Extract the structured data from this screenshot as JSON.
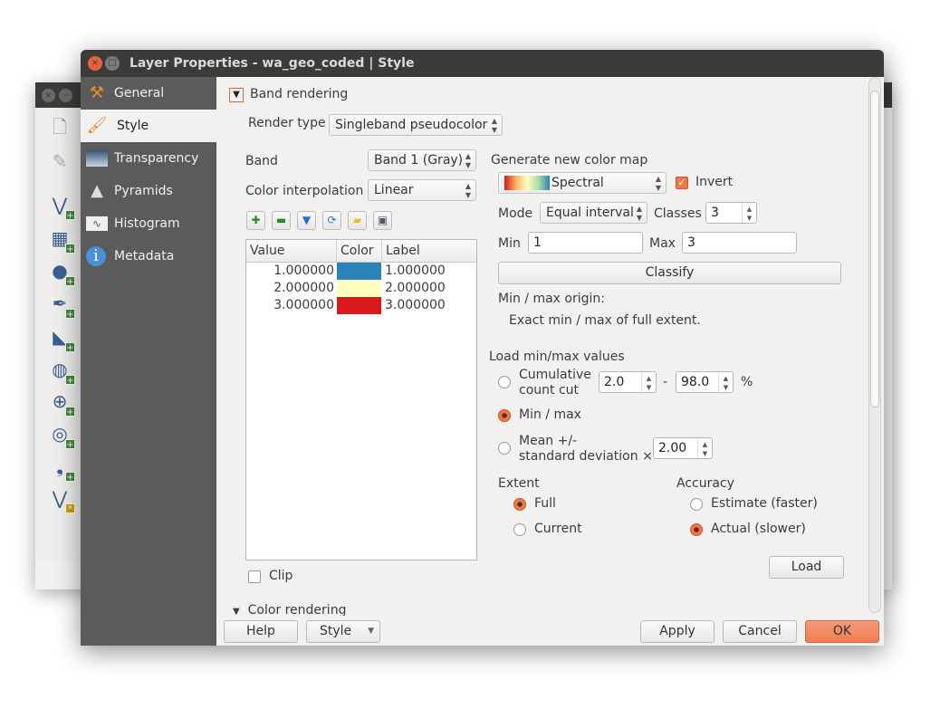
{
  "background_window": {
    "toolbar_icons": [
      "new-project-icon",
      "edit-pencil-icon",
      "add-vector-layer-icon",
      "add-raster-layer-icon",
      "add-postgis-layer-icon",
      "add-spatialite-layer-icon",
      "add-mssql-layer-icon",
      "add-wms-layer-icon",
      "add-wcs-layer-icon",
      "add-wfs-layer-icon",
      "add-delimited-text-layer-icon",
      "new-shapefile-layer-icon"
    ]
  },
  "dialog": {
    "title": "Layer Properties - wa_geo_coded | Style"
  },
  "sidebar": {
    "items": [
      {
        "label": "General",
        "icon": "tools-icon"
      },
      {
        "label": "Style",
        "icon": "paintbrush-icon",
        "selected": true
      },
      {
        "label": "Transparency",
        "icon": "transparency-icon"
      },
      {
        "label": "Pyramids",
        "icon": "pyramids-icon"
      },
      {
        "label": "Histogram",
        "icon": "histogram-icon"
      },
      {
        "label": "Metadata",
        "icon": "info-icon"
      }
    ]
  },
  "band_rendering": {
    "section_label": "Band rendering",
    "render_type_label": "Render type",
    "render_type": "Singleband pseudocolor",
    "band_label": "Band",
    "band": "Band 1 (Gray)",
    "interp_label": "Color interpolation",
    "interp": "Linear",
    "table": {
      "headers": [
        "Value",
        "Color",
        "Label"
      ],
      "rows": [
        {
          "value": "1.000000",
          "color": "#2b83ba",
          "label": "1.000000"
        },
        {
          "value": "2.000000",
          "color": "#ffffbf",
          "label": "2.000000"
        },
        {
          "value": "3.000000",
          "color": "#d7191c",
          "label": "3.000000"
        }
      ]
    },
    "clip_label": "Clip",
    "clip_checked": false
  },
  "color_map": {
    "title": "Generate new color map",
    "ramp": "Spectral",
    "invert_label": "Invert",
    "invert_checked": true,
    "mode_label": "Mode",
    "mode": "Equal interval",
    "classes_label": "Classes",
    "classes": "3",
    "min_label": "Min",
    "min": "1",
    "max_label": "Max",
    "max": "3",
    "classify_label": "Classify",
    "origin_label": "Min / max origin:",
    "origin_value": "Exact min / max of full extent."
  },
  "load_minmax": {
    "title": "Load min/max values",
    "cumulative_label_1": "Cumulative",
    "cumulative_label_2": "count cut",
    "cum_low": "2.0",
    "dash": "-",
    "cum_high": "98.0",
    "percent": "%",
    "minmax_label": "Min / max",
    "mean_label_1": "Mean +/-",
    "mean_label_2": "standard deviation ×",
    "stddev": "2.00",
    "selected": "Min / max",
    "extent_label": "Extent",
    "extent_full": "Full",
    "extent_current": "Current",
    "extent_selected": "Full",
    "accuracy_label": "Accuracy",
    "acc_estimate": "Estimate (faster)",
    "acc_actual": "Actual (slower)",
    "accuracy_selected": "Actual (slower)",
    "load_label": "Load"
  },
  "color_rendering_label": "Color rendering",
  "footer": {
    "help": "Help",
    "style": "Style",
    "apply": "Apply",
    "cancel": "Cancel",
    "ok": "OK"
  },
  "colors": {
    "accent": "#f07746",
    "titlebar": "#3c3b37",
    "sidebar": "#5b5b5b"
  }
}
